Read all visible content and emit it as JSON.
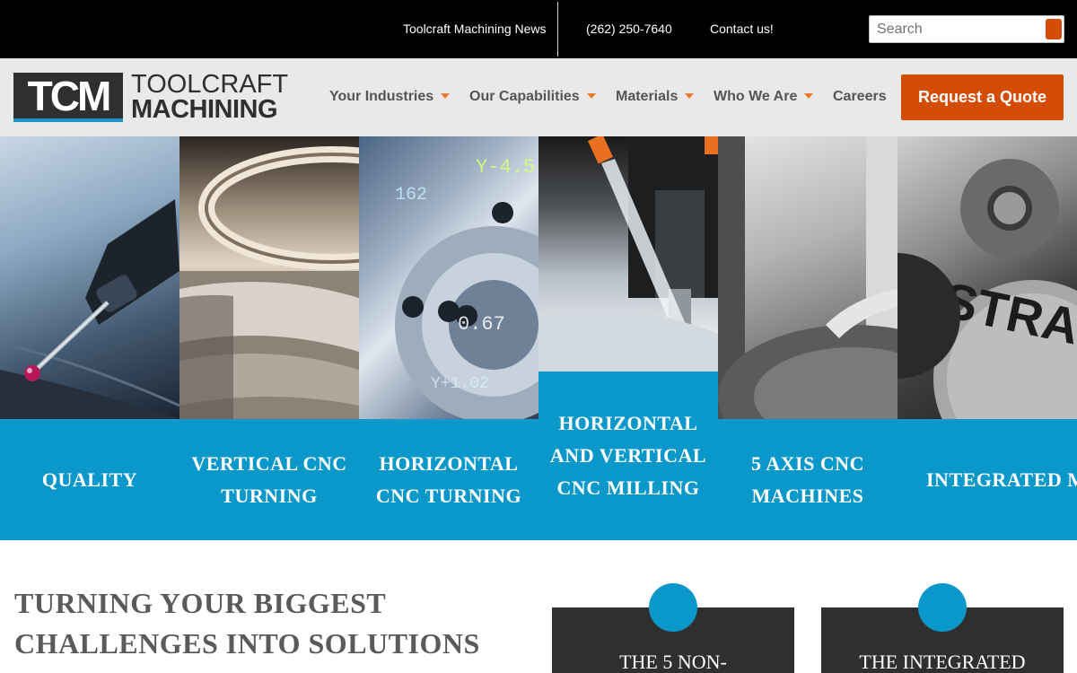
{
  "topbar": {
    "news": "Toolcraft Machining News",
    "phone": "(262) 250-7640",
    "contact": "Contact us!",
    "search_placeholder": "Search"
  },
  "brand": {
    "logo_mark": "TCM",
    "logo_line1": "TOOLCRAFT",
    "logo_line2": "MACHINING",
    "accent_color": "#d44d07",
    "blue_color": "#0a97c9"
  },
  "nav": {
    "items": [
      {
        "label": "Your Industries",
        "dropdown": true
      },
      {
        "label": "Our Capabilities",
        "dropdown": true
      },
      {
        "label": "Materials",
        "dropdown": true
      },
      {
        "label": "Who We Are",
        "dropdown": true
      },
      {
        "label": "Careers",
        "dropdown": false
      }
    ],
    "cta": "Request a Quote"
  },
  "tiles": [
    {
      "label": "QUALITY",
      "image": "cmm-probe-photo"
    },
    {
      "label": "VERTICAL CNC TURNING",
      "image": "turned-ring-photo"
    },
    {
      "label": "HORIZONTAL CNC TURNING",
      "image": "lathe-readout-photo"
    },
    {
      "label": "HORIZONTAL AND VERTICAL CNC MILLING",
      "image": "milling-coolant-photo"
    },
    {
      "label": "5 AXIS CNC MACHINES",
      "image": "five-axis-machine-photo"
    },
    {
      "label": "INTEGRATED MANUFACTURING SOLUTIONS",
      "image": "strategy-gears-photo"
    }
  ],
  "intro": {
    "title_line1": "TURNING YOUR BIGGEST",
    "title_line2": "CHALLENGES INTO SOLUTIONS",
    "cards": [
      {
        "title": "THE 5 NON-"
      },
      {
        "title": "THE INTEGRATED"
      }
    ]
  }
}
